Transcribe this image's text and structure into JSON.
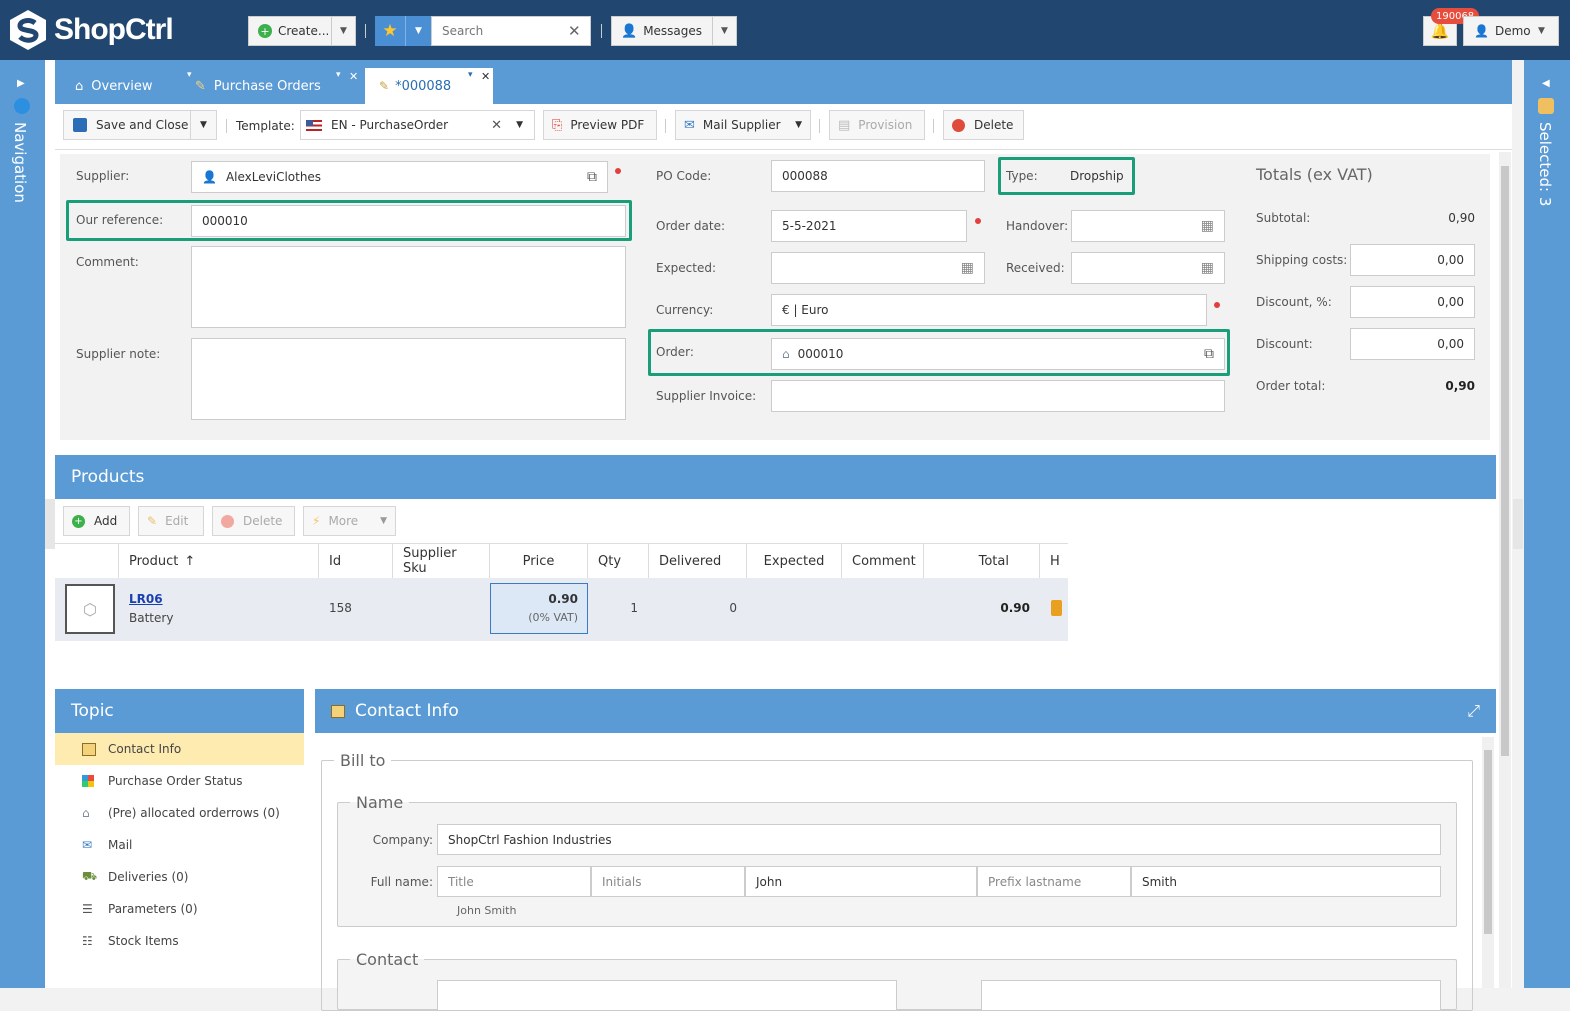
{
  "app": {
    "logo": "ShopCtrl",
    "user": "Demo",
    "notif_badge": "190068"
  },
  "topbar": {
    "create_label": "Create...",
    "search_placeholder": "Search",
    "messages_label": "Messages"
  },
  "nav": {
    "left_label": "Navigation",
    "right_label": "Selected: 3"
  },
  "tabs": [
    {
      "label": "Overview"
    },
    {
      "label": "Purchase Orders"
    },
    {
      "label": "*000088"
    }
  ],
  "toolbar": {
    "save_close": "Save and Close",
    "template_label": "Template:",
    "template_value": "EN - PurchaseOrder",
    "preview_pdf": "Preview PDF",
    "mail_supplier": "Mail Supplier",
    "provision": "Provision",
    "delete": "Delete"
  },
  "form": {
    "supplier_label": "Supplier:",
    "supplier_value": "AlexLeviClothes",
    "our_ref_label": "Our reference:",
    "our_ref_value": "000010",
    "comment_label": "Comment:",
    "supplier_note_label": "Supplier note:",
    "po_code_label": "PO Code:",
    "po_code_value": "000088",
    "type_label": "Type:",
    "type_value": "Dropship",
    "order_date_label": "Order date:",
    "order_date_value": "5-5-2021",
    "handover_label": "Handover:",
    "expected_label": "Expected:",
    "received_label": "Received:",
    "currency_label": "Currency:",
    "currency_value": "€ | Euro",
    "order_label": "Order:",
    "order_value": "000010",
    "supplier_invoice_label": "Supplier Invoice:"
  },
  "totals": {
    "title": "Totals (ex VAT)",
    "subtotal_label": "Subtotal:",
    "subtotal_value": "0,90",
    "shipping_label": "Shipping costs:",
    "shipping_value": "0,00",
    "discount_pct_label": "Discount, %:",
    "discount_pct_value": "0,00",
    "discount_label": "Discount:",
    "discount_value": "0,00",
    "order_total_label": "Order total:",
    "order_total_value": "0,90"
  },
  "products": {
    "title": "Products",
    "toolbar": {
      "add": "Add",
      "edit": "Edit",
      "delete": "Delete",
      "more": "More"
    },
    "columns": [
      "Product",
      "Id",
      "Supplier Sku",
      "Price",
      "Qty",
      "Delivered",
      "Expected",
      "Comment",
      "Total",
      "H"
    ],
    "rows": [
      {
        "sku": "LR06",
        "name": "Battery",
        "id": "158",
        "price": "0.90",
        "vat": "(0% VAT)",
        "qty": "1",
        "delivered": "0",
        "total": "0.90"
      }
    ]
  },
  "topic": {
    "title": "Topic",
    "items": [
      {
        "label": "Contact Info"
      },
      {
        "label": "Purchase Order Status"
      },
      {
        "label": "(Pre) allocated orderrows (0)"
      },
      {
        "label": "Mail"
      },
      {
        "label": "Deliveries (0)"
      },
      {
        "label": "Parameters (0)"
      },
      {
        "label": "Stock Items"
      }
    ]
  },
  "contact": {
    "title": "Contact Info",
    "bill_to": "Bill to",
    "name_legend": "Name",
    "company_label": "Company:",
    "company_value": "ShopCtrl Fashion Industries",
    "fullname_label": "Full name:",
    "title_placeholder": "Title",
    "initials_placeholder": "Initials",
    "first_name": "John",
    "prefix_placeholder": "Prefix lastname",
    "last_name": "Smith",
    "display_name": "John Smith",
    "contact_legend": "Contact"
  }
}
